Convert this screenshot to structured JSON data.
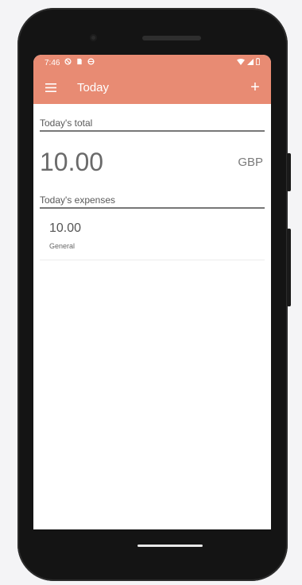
{
  "status_bar": {
    "time": "7:46"
  },
  "toolbar": {
    "menu_icon": "hamburger-menu-icon",
    "title": "Today",
    "add_label": "+"
  },
  "total_section": {
    "header": "Today's total",
    "amount": "10.00",
    "currency": "GBP"
  },
  "expenses_section": {
    "header": "Today's expenses",
    "items": [
      {
        "amount": "10.00",
        "category": "General"
      }
    ]
  },
  "colors": {
    "accent": "#e88b73",
    "divider": "#777777",
    "phone_body": "#141414"
  }
}
